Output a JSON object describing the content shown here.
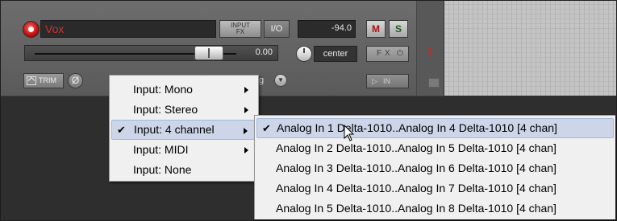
{
  "track": {
    "name": "Vox",
    "fx_top": "INPUT",
    "fx_bottom": "FX",
    "io_label": "I/O",
    "peak_db": "-94.0",
    "mute_label": "M",
    "solo_label": "S",
    "fader_db": "0.00",
    "pan_label": "center",
    "fx_group": [
      "F",
      "X",
      "⏻"
    ],
    "track_number": "1",
    "trim_label": "TRIM",
    "phase_symbol": "Ø",
    "automation_partial": "g",
    "automation_dropdown": "▼",
    "input_btn_arrow": "▷",
    "input_btn_label": "IN"
  },
  "colors": {
    "record_red": "#d82020",
    "menu_bg": "#f0f0f0",
    "menu_highlight": "#ccd6e8"
  },
  "input_menu": {
    "items": [
      {
        "label": "Input: Mono",
        "checked": false,
        "submenu": true
      },
      {
        "label": "Input: Stereo",
        "checked": false,
        "submenu": true
      },
      {
        "label": "Input: 4 channel",
        "checked": true,
        "submenu": true,
        "highlighted": true
      },
      {
        "label": "Input: MIDI",
        "checked": false,
        "submenu": true
      },
      {
        "label": "Input: None",
        "checked": false,
        "submenu": false
      }
    ]
  },
  "channel_submenu": {
    "items": [
      {
        "label": "Analog In 1 Delta-1010..Analog In 4 Delta-1010 [4 chan]",
        "checked": true,
        "highlighted": true
      },
      {
        "label": "Analog In 2 Delta-1010..Analog In 5 Delta-1010 [4 chan]",
        "checked": false
      },
      {
        "label": "Analog In 3 Delta-1010..Analog In 6 Delta-1010 [4 chan]",
        "checked": false
      },
      {
        "label": "Analog In 4 Delta-1010..Analog In 7 Delta-1010 [4 chan]",
        "checked": false
      },
      {
        "label": "Analog In 5 Delta-1010..Analog In 8 Delta-1010 [4 chan]",
        "checked": false
      }
    ]
  },
  "check_glyph": "✔",
  "icons": [
    "record-arm-icon",
    "trim-envelope-icon",
    "phase-invert-icon",
    "dropdown-icon",
    "fx-power-icon",
    "input-play-icon",
    "folder-icon",
    "submenu-arrow-icon",
    "checkmark-icon",
    "mouse-cursor-icon"
  ]
}
